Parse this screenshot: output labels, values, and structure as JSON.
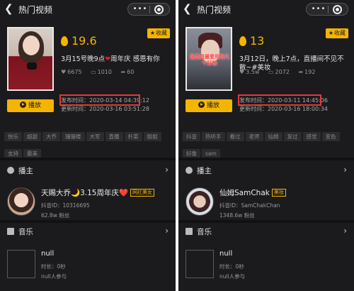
{
  "panels": [
    {
      "header_title": "热门视频",
      "fav_label": "收藏",
      "heat": "19.6",
      "title_a": "3月15号晚9点",
      "title_b": "周年庆 感恩有你",
      "likes": "6675",
      "comments": "1010",
      "shares": "60",
      "play_label": "播放",
      "publish_time": "发布时间：2020-03-14 04:39:12",
      "update_time": "更新时间：2020-03-16 03:51:28",
      "tags": [
        "快乐",
        "超甜",
        "大乔",
        "珊珊楼",
        "大军",
        "直播",
        "扑菜",
        "姐姐",
        "支持",
        "最美"
      ],
      "host_section": "播主",
      "host_name": "天赐大乔🌙3.15周年庆❤️",
      "host_badge": "网红美女",
      "host_id": "抖音ID：10316695",
      "host_fans": "62.8w 粉丝",
      "music_section": "音乐",
      "music_name": "null",
      "music_duration": "时长：0秒",
      "music_users": "null人参与"
    },
    {
      "header_title": "热门视频",
      "fav_label": "收藏",
      "heat": "13",
      "title_a": "3月12日，晚上7点，直播间不见不散~#美妆",
      "title_b": "",
      "likes": "3.5w",
      "comments": "2072",
      "shares": "192",
      "play_label": "播放",
      "publish_time": "发布时间：2020-03-11 14:45:06",
      "update_time": "更新时间：2020-03-16 18:00:34",
      "tags": [
        "抖音",
        "热听手",
        "看过",
        "老师",
        "仙姆",
        "发过",
        "感觉",
        "变色",
        "好像",
        "sam"
      ],
      "host_section": "播主",
      "host_name": "仙姆SamChak",
      "host_badge": "美妆",
      "host_id": "抖音ID：SamChakChan",
      "host_fans": "1348.6w 粉丝",
      "music_section": "音乐",
      "music_name": "null",
      "music_duration": "时长：0秒",
      "music_users": "null人参与"
    }
  ],
  "cover_overlay_text": "这是我最爱用的几个好物",
  "colors": {
    "accent": "#f5b400",
    "background": "#1b1b1d",
    "highlight": "#e23a3a"
  }
}
